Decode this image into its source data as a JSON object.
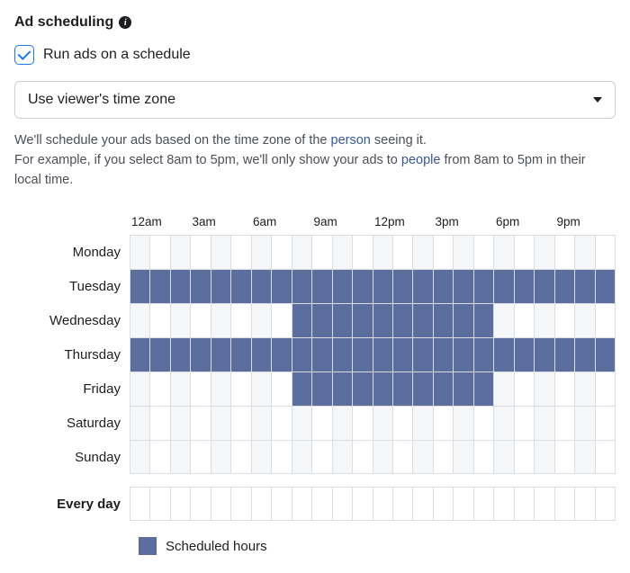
{
  "header": {
    "title": "Ad scheduling",
    "info_icon": "info-icon"
  },
  "run_on_schedule": {
    "checked": true,
    "label": "Run ads on a schedule"
  },
  "timezone_select": {
    "value": "Use viewer's time zone"
  },
  "helper": {
    "line1_prefix": "We'll schedule your ads based on the time zone of the ",
    "line1_link": "person",
    "line1_suffix": " seeing it.",
    "line2_prefix": "For example, if you select 8am to 5pm, we'll only show your ads to ",
    "line2_link": "people",
    "line2_suffix": " from 8am to 5pm in their local time."
  },
  "schedule": {
    "hour_headers": [
      "12am",
      "3am",
      "6am",
      "9am",
      "12pm",
      "3pm",
      "6pm",
      "9pm"
    ],
    "days": [
      {
        "label": "Monday",
        "selected_hours": []
      },
      {
        "label": "Tuesday",
        "selected_hours": [
          0,
          1,
          2,
          3,
          4,
          5,
          6,
          7,
          8,
          9,
          10,
          11,
          12,
          13,
          14,
          15,
          16,
          17,
          18,
          19,
          20,
          21,
          22,
          23
        ]
      },
      {
        "label": "Wednesday",
        "selected_hours": [
          8,
          9,
          10,
          11,
          12,
          13,
          14,
          15,
          16,
          17
        ]
      },
      {
        "label": "Thursday",
        "selected_hours": [
          0,
          1,
          2,
          3,
          4,
          5,
          6,
          7,
          8,
          9,
          10,
          11,
          12,
          13,
          14,
          15,
          16,
          17,
          18,
          19,
          20,
          21,
          22,
          23
        ]
      },
      {
        "label": "Friday",
        "selected_hours": [
          8,
          9,
          10,
          11,
          12,
          13,
          14,
          15,
          16,
          17
        ]
      },
      {
        "label": "Saturday",
        "selected_hours": []
      },
      {
        "label": "Sunday",
        "selected_hours": []
      }
    ],
    "every_day_label": "Every day",
    "legend_label": "Scheduled hours"
  }
}
